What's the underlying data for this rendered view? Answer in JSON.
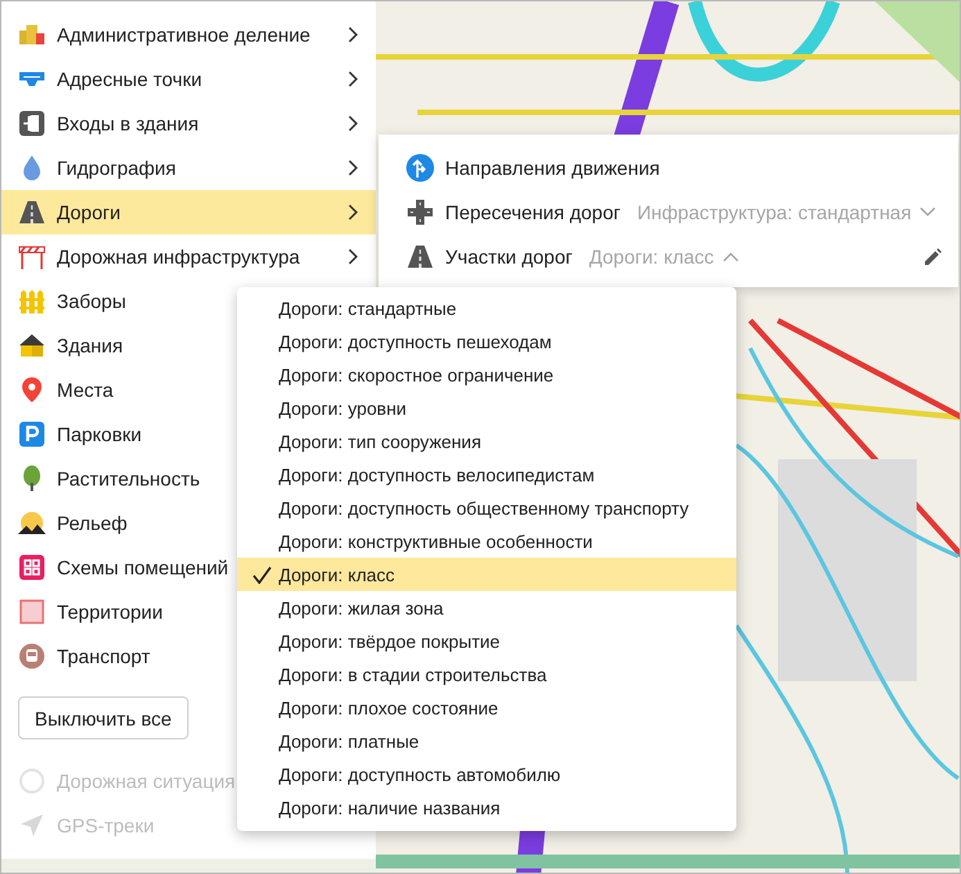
{
  "layers": [
    {
      "label": "Административное деление",
      "submenu": true,
      "selected": false
    },
    {
      "label": "Адресные точки",
      "submenu": true,
      "selected": false
    },
    {
      "label": "Входы в здания",
      "submenu": true,
      "selected": false
    },
    {
      "label": "Гидрография",
      "submenu": true,
      "selected": false
    },
    {
      "label": "Дороги",
      "submenu": true,
      "selected": true
    },
    {
      "label": "Дорожная инфраструктура",
      "submenu": true,
      "selected": false
    },
    {
      "label": "Заборы",
      "selected": false
    },
    {
      "label": "Здания",
      "selected": false
    },
    {
      "label": "Места",
      "selected": false
    },
    {
      "label": "Парковки",
      "selected": false
    },
    {
      "label": "Растительность",
      "selected": false
    },
    {
      "label": "Рельеф",
      "selected": false
    },
    {
      "label": "Схемы помещений",
      "selected": false
    },
    {
      "label": "Территории",
      "selected": false
    },
    {
      "label": "Транспорт",
      "selected": false
    }
  ],
  "turn_off_all_button": "Выключить все",
  "extra_layers": [
    {
      "label": "Дорожная ситуация",
      "disabled": true
    },
    {
      "label": "GPS-треки",
      "disabled": true
    }
  ],
  "roads_panel": {
    "rows": [
      {
        "label": "Направления движения"
      },
      {
        "label": "Пересечения дорог",
        "style": "Инфраструктура: стандартная",
        "expanded": false
      },
      {
        "label": "Участки дорог",
        "style": "Дороги: класс",
        "expanded": true,
        "editable": true
      }
    ]
  },
  "style_dropdown": {
    "options": [
      {
        "label": "Дороги: стандартные",
        "selected": false
      },
      {
        "label": "Дороги: доступность пешеходам",
        "selected": false
      },
      {
        "label": "Дороги: скоростное ограничение",
        "selected": false
      },
      {
        "label": "Дороги: уровни",
        "selected": false
      },
      {
        "label": "Дороги: тип сооружения",
        "selected": false
      },
      {
        "label": "Дороги: доступность велосипедистам",
        "selected": false
      },
      {
        "label": "Дороги: доступность общественному транспорту",
        "selected": false
      },
      {
        "label": "Дороги: конструктивные особенности",
        "selected": false
      },
      {
        "label": "Дороги: класс",
        "selected": true
      },
      {
        "label": "Дороги: жилая зона",
        "selected": false
      },
      {
        "label": "Дороги: твёрдое покрытие",
        "selected": false
      },
      {
        "label": "Дороги: в стадии строительства",
        "selected": false
      },
      {
        "label": "Дороги: плохое состояние",
        "selected": false
      },
      {
        "label": "Дороги: платные",
        "selected": false
      },
      {
        "label": "Дороги: доступность автомобилю",
        "selected": false
      },
      {
        "label": "Дороги: наличие названия",
        "selected": false
      }
    ]
  }
}
